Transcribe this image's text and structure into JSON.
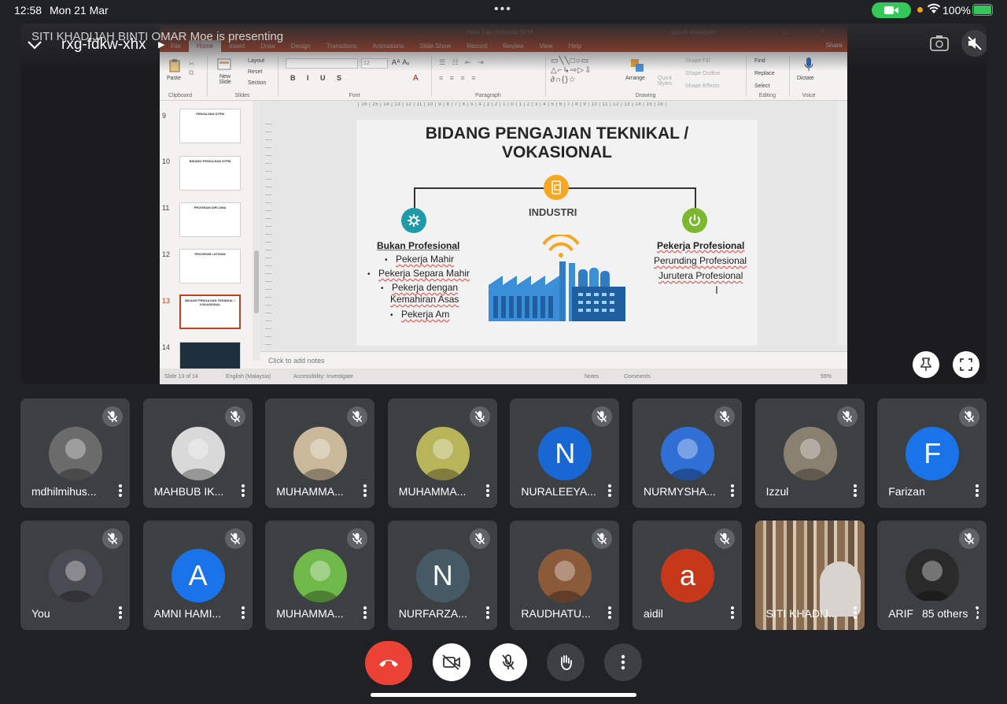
{
  "status_bar": {
    "time": "12:58",
    "date": "Mon 21 Mar",
    "battery": "100%"
  },
  "stage": {
    "presenting_banner": "SITI KHADIJAH BINTI OMAR Moe is presenting",
    "meeting_code": "rxg-fdkw-xhx"
  },
  "ppt": {
    "doc_title": "Hala Tuju Selepas SPM",
    "user": "qaseh khadijah",
    "tabs": [
      "File",
      "Home",
      "Insert",
      "Draw",
      "Design",
      "Transitions",
      "Animations",
      "Slide Show",
      "Record",
      "Review",
      "View",
      "Help"
    ],
    "share": "Share",
    "ribbon": {
      "paste": "Paste",
      "new_slide": "New Slide",
      "layout": "Layout",
      "reset": "Reset",
      "section": "Section",
      "groups": [
        "Clipboard",
        "Slides",
        "Font",
        "Paragraph",
        "Drawing",
        "Editing",
        "Voice"
      ],
      "arrange": "Arrange",
      "quick_styles": "Quick Styles",
      "shape_fill": "Shape Fill",
      "shape_outline": "Shape Outline",
      "shape_effects": "Shape Effects",
      "find": "Find",
      "replace": "Replace",
      "select": "Select",
      "dictate": "Dictate",
      "font_size": "12"
    },
    "ruler": "| 16 | 15 | 14 | 13 | 12 | 11 | 10 | 9 | 8 | 7 | 6 | 5 | 4 | 3 | 2 | 1 | 0 | 1 | 2 | 3 | 4 | 5 | 6 | 7 | 8 | 9 | 10 | 11 | 12 | 13 | 14 | 15 | 16 |",
    "thumbnails": [
      {
        "num": "9",
        "label": "PENGAJIAN STPM"
      },
      {
        "num": "10",
        "label": "BIDANG PENGAJIAN STPM"
      },
      {
        "num": "11",
        "label": "PROGRAM DIPLOMA"
      },
      {
        "num": "12",
        "label": "PROGRAM LATIHAN"
      },
      {
        "num": "13",
        "label": "BIDANG PENGAJIAN TEKNIKAL / VOKASIONAL"
      },
      {
        "num": "14",
        "label": ""
      }
    ],
    "notes_placeholder": "Click to add notes",
    "statusbar": {
      "slide_counter": "Slide 13 of 14",
      "language": "English (Malaysia)",
      "accessibility": "Accessibility: Investigate",
      "notes": "Notes",
      "comments": "Comments",
      "zoom": "59%"
    },
    "slide": {
      "title_line1": "BIDANG PENGAJIAN TEKNIKAL /",
      "title_line2": "VOKASIONAL",
      "center_label": "INDUSTRI",
      "left_header": "Bukan Profesional",
      "left_items": [
        "Pekerja Mahir",
        "Pekerja Separa Mahir",
        "Pekerja dengan",
        "Kemahiran Asas",
        "Pekerja Am"
      ],
      "right_header": "Pekerja Profesional",
      "right_items": [
        "Perunding Profesional",
        "Jurutera Profesional"
      ],
      "colors": {
        "orange": "#f5a623",
        "teal": "#1e9aa8",
        "green": "#7cb82f",
        "factory_blue": "#2f8fd8"
      }
    }
  },
  "participants": [
    {
      "name": "mdhilmihus...",
      "avatar": "photo",
      "bg": "#6b6b6b"
    },
    {
      "name": "MAHBUB IK...",
      "avatar": "photo",
      "bg": "#d9d9d9"
    },
    {
      "name": "MUHAMMA...",
      "avatar": "photo",
      "bg": "#c9b89a"
    },
    {
      "name": "MUHAMMA...",
      "avatar": "photo",
      "bg": "#b8b45a"
    },
    {
      "name": "NURALEEYA...",
      "avatar": "N",
      "bg": "#1967d2"
    },
    {
      "name": "NURMYSHA...",
      "avatar": "photo",
      "bg": "#2f6fd6"
    },
    {
      "name": "Izzul",
      "avatar": "photo",
      "bg": "#8a8070"
    },
    {
      "name": "Farizan",
      "avatar": "F",
      "bg": "#1a73e8"
    },
    {
      "name": "You",
      "avatar": "photo",
      "bg": "#4a4a52"
    },
    {
      "name": "AMNI HAMI...",
      "avatar": "A",
      "bg": "#1a73e8"
    },
    {
      "name": "MUHAMMA...",
      "avatar": "photo",
      "bg": "#6fb84a"
    },
    {
      "name": "NURFARZA...",
      "avatar": "N",
      "bg": "#455a64"
    },
    {
      "name": "RAUDHATU...",
      "avatar": "photo",
      "bg": "#8a5a3a"
    },
    {
      "name": "aidil",
      "avatar": "a",
      "bg": "#c5391a"
    },
    {
      "name": "SITI KHADIJ...",
      "avatar": "video",
      "bg": "#7a6a5a"
    },
    {
      "name": "ARIF",
      "avatar": "photo",
      "bg": "#2a2a2a"
    }
  ],
  "others_label": "85 others",
  "controls": {
    "end_call_color": "#ea4335"
  }
}
